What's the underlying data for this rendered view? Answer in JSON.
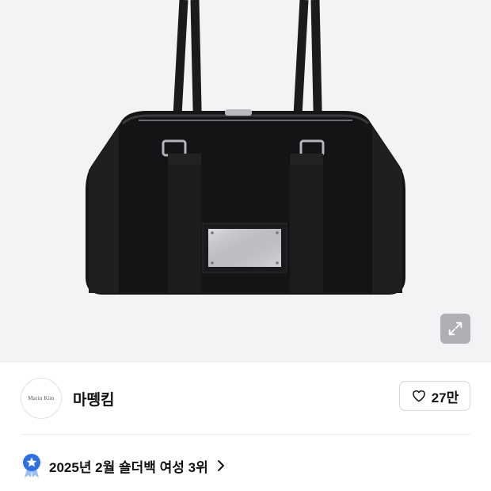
{
  "product": {
    "image_alt": "black shoulder bag with silver plate",
    "expand_icon": "expand-arrows-icon"
  },
  "brand": {
    "logo_text": "Matin Kim",
    "name": "마뗑킴"
  },
  "like": {
    "icon": "heart-outline-icon",
    "count": "27만"
  },
  "ranking": {
    "badge_icon": "star-medal-icon",
    "text": "2025년 2월 숄더백 여성 3위",
    "chevron_icon": "chevron-right-icon"
  },
  "colors": {
    "badge_blue": "#2f6fe4",
    "badge_light": "#9dbdf5",
    "hero_bg": "#f3f3f5"
  }
}
